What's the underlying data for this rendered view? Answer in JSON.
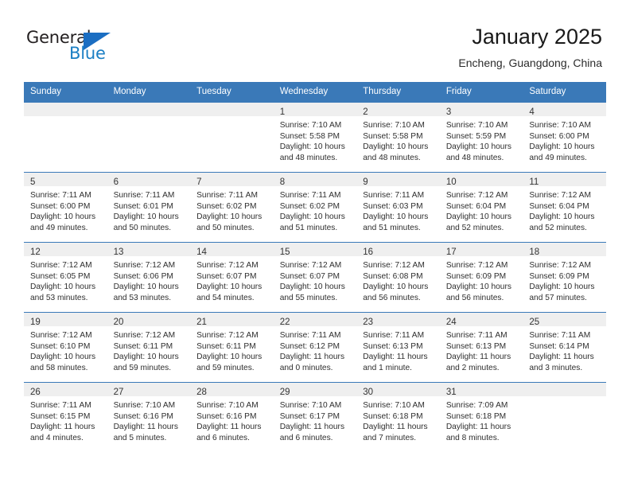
{
  "brand": {
    "name_part1": "General",
    "name_part2": "Blue",
    "accent_color": "#1b7fc4",
    "triangle_icon": "blue-triangle-icon"
  },
  "header": {
    "title": "January 2025",
    "subtitle": "Encheng, Guangdong, China"
  },
  "calendar": {
    "header_bg": "#3a79b8",
    "daynum_bg": "#efefef",
    "weekday_headers": [
      "Sunday",
      "Monday",
      "Tuesday",
      "Wednesday",
      "Thursday",
      "Friday",
      "Saturday"
    ],
    "weeks": [
      [
        {
          "day": "",
          "sunrise": "",
          "sunset": "",
          "daylight1": "",
          "daylight2": ""
        },
        {
          "day": "",
          "sunrise": "",
          "sunset": "",
          "daylight1": "",
          "daylight2": ""
        },
        {
          "day": "",
          "sunrise": "",
          "sunset": "",
          "daylight1": "",
          "daylight2": ""
        },
        {
          "day": "1",
          "sunrise": "Sunrise: 7:10 AM",
          "sunset": "Sunset: 5:58 PM",
          "daylight1": "Daylight: 10 hours",
          "daylight2": "and 48 minutes."
        },
        {
          "day": "2",
          "sunrise": "Sunrise: 7:10 AM",
          "sunset": "Sunset: 5:58 PM",
          "daylight1": "Daylight: 10 hours",
          "daylight2": "and 48 minutes."
        },
        {
          "day": "3",
          "sunrise": "Sunrise: 7:10 AM",
          "sunset": "Sunset: 5:59 PM",
          "daylight1": "Daylight: 10 hours",
          "daylight2": "and 48 minutes."
        },
        {
          "day": "4",
          "sunrise": "Sunrise: 7:10 AM",
          "sunset": "Sunset: 6:00 PM",
          "daylight1": "Daylight: 10 hours",
          "daylight2": "and 49 minutes."
        }
      ],
      [
        {
          "day": "5",
          "sunrise": "Sunrise: 7:11 AM",
          "sunset": "Sunset: 6:00 PM",
          "daylight1": "Daylight: 10 hours",
          "daylight2": "and 49 minutes."
        },
        {
          "day": "6",
          "sunrise": "Sunrise: 7:11 AM",
          "sunset": "Sunset: 6:01 PM",
          "daylight1": "Daylight: 10 hours",
          "daylight2": "and 50 minutes."
        },
        {
          "day": "7",
          "sunrise": "Sunrise: 7:11 AM",
          "sunset": "Sunset: 6:02 PM",
          "daylight1": "Daylight: 10 hours",
          "daylight2": "and 50 minutes."
        },
        {
          "day": "8",
          "sunrise": "Sunrise: 7:11 AM",
          "sunset": "Sunset: 6:02 PM",
          "daylight1": "Daylight: 10 hours",
          "daylight2": "and 51 minutes."
        },
        {
          "day": "9",
          "sunrise": "Sunrise: 7:11 AM",
          "sunset": "Sunset: 6:03 PM",
          "daylight1": "Daylight: 10 hours",
          "daylight2": "and 51 minutes."
        },
        {
          "day": "10",
          "sunrise": "Sunrise: 7:12 AM",
          "sunset": "Sunset: 6:04 PM",
          "daylight1": "Daylight: 10 hours",
          "daylight2": "and 52 minutes."
        },
        {
          "day": "11",
          "sunrise": "Sunrise: 7:12 AM",
          "sunset": "Sunset: 6:04 PM",
          "daylight1": "Daylight: 10 hours",
          "daylight2": "and 52 minutes."
        }
      ],
      [
        {
          "day": "12",
          "sunrise": "Sunrise: 7:12 AM",
          "sunset": "Sunset: 6:05 PM",
          "daylight1": "Daylight: 10 hours",
          "daylight2": "and 53 minutes."
        },
        {
          "day": "13",
          "sunrise": "Sunrise: 7:12 AM",
          "sunset": "Sunset: 6:06 PM",
          "daylight1": "Daylight: 10 hours",
          "daylight2": "and 53 minutes."
        },
        {
          "day": "14",
          "sunrise": "Sunrise: 7:12 AM",
          "sunset": "Sunset: 6:07 PM",
          "daylight1": "Daylight: 10 hours",
          "daylight2": "and 54 minutes."
        },
        {
          "day": "15",
          "sunrise": "Sunrise: 7:12 AM",
          "sunset": "Sunset: 6:07 PM",
          "daylight1": "Daylight: 10 hours",
          "daylight2": "and 55 minutes."
        },
        {
          "day": "16",
          "sunrise": "Sunrise: 7:12 AM",
          "sunset": "Sunset: 6:08 PM",
          "daylight1": "Daylight: 10 hours",
          "daylight2": "and 56 minutes."
        },
        {
          "day": "17",
          "sunrise": "Sunrise: 7:12 AM",
          "sunset": "Sunset: 6:09 PM",
          "daylight1": "Daylight: 10 hours",
          "daylight2": "and 56 minutes."
        },
        {
          "day": "18",
          "sunrise": "Sunrise: 7:12 AM",
          "sunset": "Sunset: 6:09 PM",
          "daylight1": "Daylight: 10 hours",
          "daylight2": "and 57 minutes."
        }
      ],
      [
        {
          "day": "19",
          "sunrise": "Sunrise: 7:12 AM",
          "sunset": "Sunset: 6:10 PM",
          "daylight1": "Daylight: 10 hours",
          "daylight2": "and 58 minutes."
        },
        {
          "day": "20",
          "sunrise": "Sunrise: 7:12 AM",
          "sunset": "Sunset: 6:11 PM",
          "daylight1": "Daylight: 10 hours",
          "daylight2": "and 59 minutes."
        },
        {
          "day": "21",
          "sunrise": "Sunrise: 7:12 AM",
          "sunset": "Sunset: 6:11 PM",
          "daylight1": "Daylight: 10 hours",
          "daylight2": "and 59 minutes."
        },
        {
          "day": "22",
          "sunrise": "Sunrise: 7:11 AM",
          "sunset": "Sunset: 6:12 PM",
          "daylight1": "Daylight: 11 hours",
          "daylight2": "and 0 minutes."
        },
        {
          "day": "23",
          "sunrise": "Sunrise: 7:11 AM",
          "sunset": "Sunset: 6:13 PM",
          "daylight1": "Daylight: 11 hours",
          "daylight2": "and 1 minute."
        },
        {
          "day": "24",
          "sunrise": "Sunrise: 7:11 AM",
          "sunset": "Sunset: 6:13 PM",
          "daylight1": "Daylight: 11 hours",
          "daylight2": "and 2 minutes."
        },
        {
          "day": "25",
          "sunrise": "Sunrise: 7:11 AM",
          "sunset": "Sunset: 6:14 PM",
          "daylight1": "Daylight: 11 hours",
          "daylight2": "and 3 minutes."
        }
      ],
      [
        {
          "day": "26",
          "sunrise": "Sunrise: 7:11 AM",
          "sunset": "Sunset: 6:15 PM",
          "daylight1": "Daylight: 11 hours",
          "daylight2": "and 4 minutes."
        },
        {
          "day": "27",
          "sunrise": "Sunrise: 7:10 AM",
          "sunset": "Sunset: 6:16 PM",
          "daylight1": "Daylight: 11 hours",
          "daylight2": "and 5 minutes."
        },
        {
          "day": "28",
          "sunrise": "Sunrise: 7:10 AM",
          "sunset": "Sunset: 6:16 PM",
          "daylight1": "Daylight: 11 hours",
          "daylight2": "and 6 minutes."
        },
        {
          "day": "29",
          "sunrise": "Sunrise: 7:10 AM",
          "sunset": "Sunset: 6:17 PM",
          "daylight1": "Daylight: 11 hours",
          "daylight2": "and 6 minutes."
        },
        {
          "day": "30",
          "sunrise": "Sunrise: 7:10 AM",
          "sunset": "Sunset: 6:18 PM",
          "daylight1": "Daylight: 11 hours",
          "daylight2": "and 7 minutes."
        },
        {
          "day": "31",
          "sunrise": "Sunrise: 7:09 AM",
          "sunset": "Sunset: 6:18 PM",
          "daylight1": "Daylight: 11 hours",
          "daylight2": "and 8 minutes."
        },
        {
          "day": "",
          "sunrise": "",
          "sunset": "",
          "daylight1": "",
          "daylight2": ""
        }
      ]
    ]
  }
}
